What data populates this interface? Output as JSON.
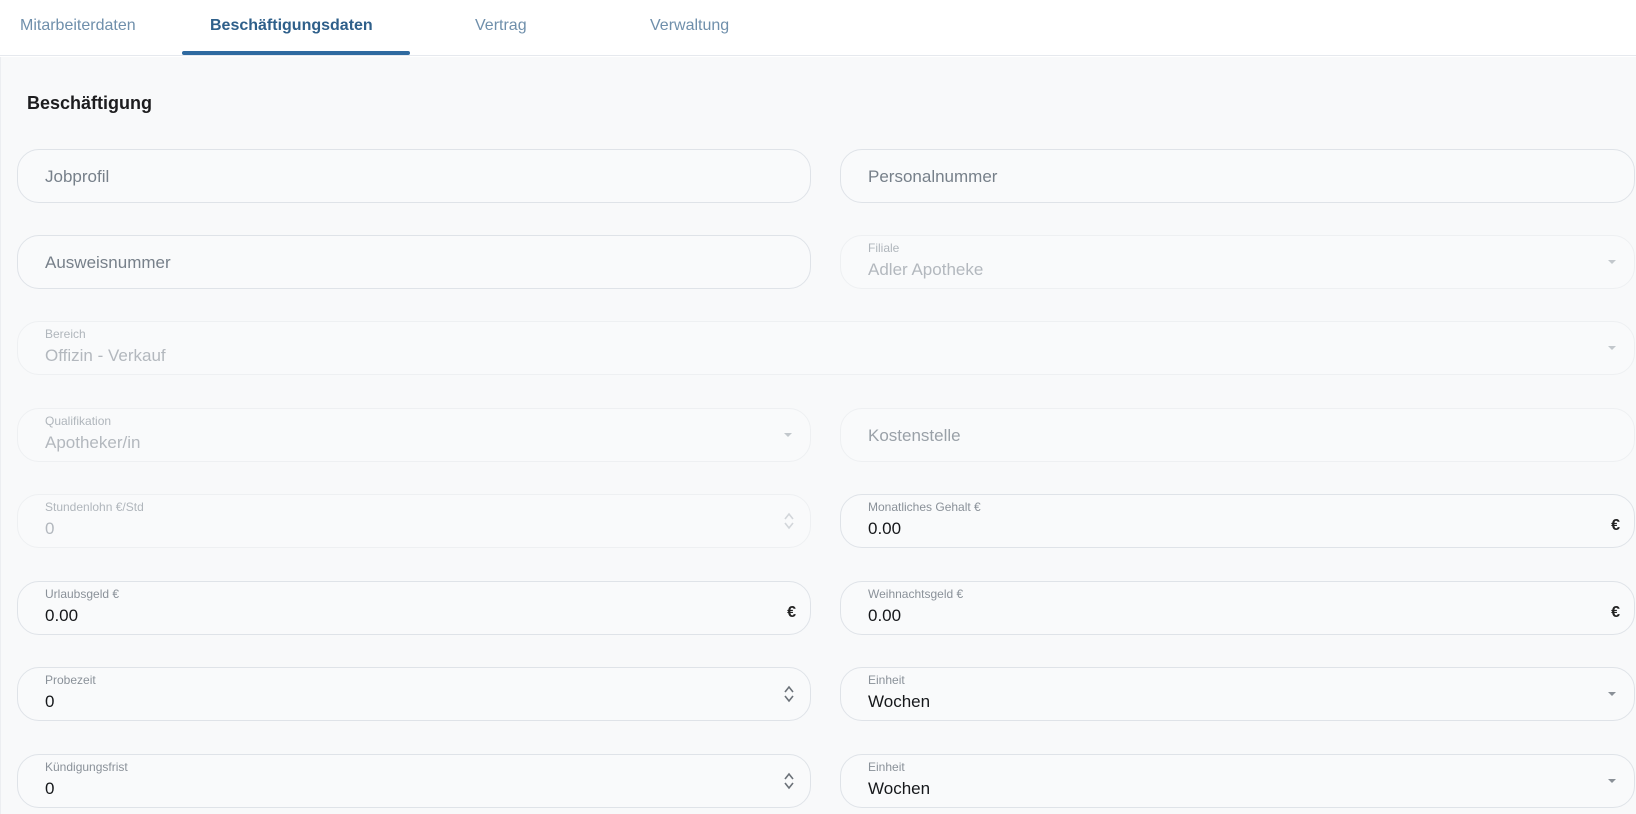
{
  "tabs": [
    {
      "label": "Mitarbeiterdaten"
    },
    {
      "label": "Beschäftigungsdaten"
    },
    {
      "label": "Vertrag"
    },
    {
      "label": "Verwaltung"
    }
  ],
  "active_tab": "Beschäftigungsdaten",
  "section": {
    "title": "Beschäftigung"
  },
  "fields": {
    "jobprofil": {
      "placeholder": "Jobprofil"
    },
    "personalnummer": {
      "placeholder": "Personalnummer"
    },
    "ausweisnummer": {
      "placeholder": "Ausweisnummer"
    },
    "filiale": {
      "label": "Filiale",
      "value": "Adler Apotheke"
    },
    "bereich": {
      "label": "Bereich",
      "value": "Offizin - Verkauf"
    },
    "qualifikation": {
      "label": "Qualifikation",
      "value": "Apotheker/in"
    },
    "kostenstelle": {
      "placeholder": "Kostenstelle"
    },
    "stundenlohn": {
      "label": "Stundenlohn €/Std",
      "value": "0"
    },
    "monatliches_gehalt": {
      "label": "Monatliches Gehalt €",
      "value": "0.00",
      "suffix": "€"
    },
    "urlaubsgeld": {
      "label": "Urlaubsgeld €",
      "value": "0.00",
      "suffix": "€"
    },
    "weihnachtsgeld": {
      "label": "Weihnachtsgeld €",
      "value": "0.00",
      "suffix": "€"
    },
    "probezeit": {
      "label": "Probezeit",
      "value": "0"
    },
    "probezeit_einheit": {
      "label": "Einheit",
      "value": "Wochen"
    },
    "kuendigungsfrist": {
      "label": "Kündigungsfrist",
      "value": "0"
    },
    "kuendigungsfrist_einheit": {
      "label": "Einheit",
      "value": "Wochen"
    }
  },
  "icons": {
    "select": "chevron-down-icon",
    "number": "spinner-icon"
  },
  "colors": {
    "accent": "#2f6aa0",
    "tab_inactive": "#6f8fab",
    "panel_bg": "#f8f9fa"
  }
}
